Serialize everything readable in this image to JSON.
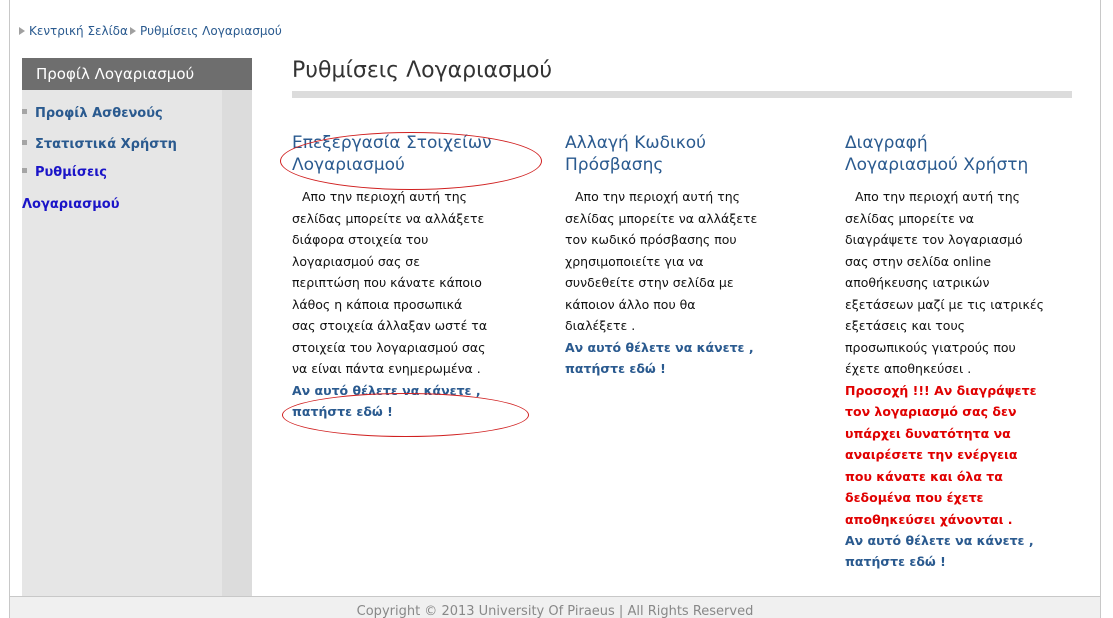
{
  "breadcrumb": {
    "items": [
      "Κεντρική Σελίδα",
      "Ρυθμίσεις Λογαριασμού"
    ]
  },
  "sidebar": {
    "header": "Προφίλ Λογαριασμού",
    "items": [
      {
        "label": "Προφίλ Ασθενούς"
      },
      {
        "label": "Στατιστικά Χρήστη"
      },
      {
        "label_line1": "Ρυθμίσεις",
        "label_line2": "Λογαριασμού"
      }
    ]
  },
  "main": {
    "title": "Ρυθμίσεις Λογαριασμού",
    "columns": [
      {
        "title_line1": "Επεξεργασία Στοιχείων",
        "title_line2": "Λογαριασμού",
        "lines": [
          "Απο την περιοχή αυτή της",
          "σελίδας μπορείτε να αλλάξετε",
          "διάφορα στοιχεία του",
          "λογαριασμού σας σε",
          "περιπτώση που κάνατε κάποιο",
          "λάθος η κάποια προσωπικά",
          "σας στοιχεία άλλαξαν ωστέ τα",
          "στοιχεία του λογαριασμού σας",
          "να είναι πάντα ενημερωμένα ."
        ],
        "link_line1": "Αν αυτό θέλετε να κάνετε ,",
        "link_line2": "πατήστε εδώ !"
      },
      {
        "title_line1": "Αλλαγή Κωδικού",
        "title_line2": "Πρόσβασης",
        "lines": [
          "Απο την περιοχή αυτή της",
          "σελίδας μπορείτε να αλλάξετε",
          "τον κωδικό πρόσβασης που",
          "χρησιμοποιείτε για να",
          "συνδεθείτε στην σελίδα με",
          "κάποιον άλλο που θα",
          "διαλέξετε ."
        ],
        "link_line1": "Αν αυτό θέλετε να κάνετε ,",
        "link_line2": "πατήστε εδώ !"
      },
      {
        "title_line1": "Διαγραφή",
        "title_line2": "Λογαριασμού Χρήστη",
        "lines": [
          "Απο την περιοχή αυτή της",
          "σελίδας μπορείτε να",
          "διαγράψετε τον λογαριασμό",
          "σας στην σελίδα online",
          "αποθήκευσης ιατρικών",
          "εξετάσεων μαζί με τις ιατρικές",
          "εξετάσεις και τους",
          "προσωπικούς γιατρούς που",
          "έχετε αποθηκεύσει ."
        ],
        "warning_lines": [
          "Προσοχή !!! Αν διαγράψετε",
          "τον λογαριασμό σας δεν",
          "υπάρχει δυνατότητα να",
          "αναιρέσετε την ενέργεια",
          "που κάνατε και όλα τα",
          "δεδομένα που έχετε",
          "αποθηκεύσει χάνονται ."
        ],
        "link_line1": "Αν αυτό θέλετε να κάνετε ,",
        "link_line2": "πατήστε εδώ !"
      }
    ]
  },
  "footer": {
    "text": "Copyright © 2013 University Of Piraeus | All Rights Reserved"
  }
}
